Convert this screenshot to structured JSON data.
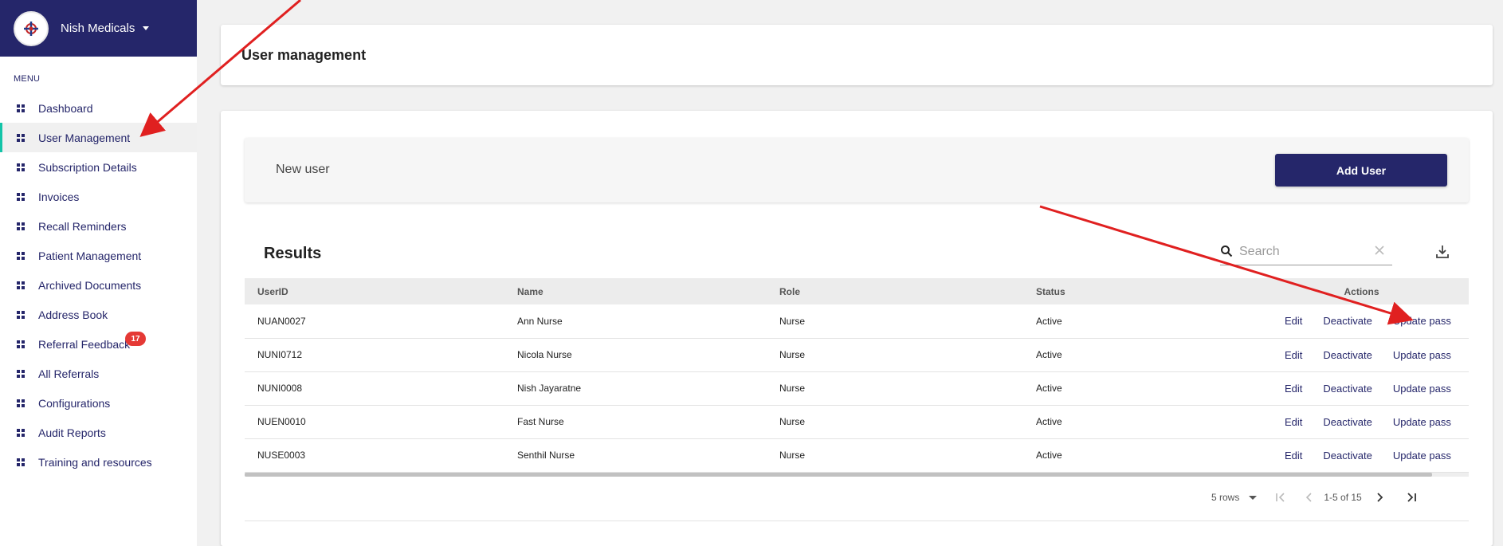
{
  "brand": {
    "name": "Nish Medicals",
    "logo_icon": "nish-medicals-logo-icon"
  },
  "sidebar": {
    "menu_title": "MENU",
    "items": [
      {
        "label": "Dashboard",
        "icon": "dashboard-icon",
        "active": false
      },
      {
        "label": "User Management",
        "icon": "dashboard-icon",
        "active": true
      },
      {
        "label": "Subscription Details",
        "icon": "dashboard-icon",
        "active": false
      },
      {
        "label": "Invoices",
        "icon": "dashboard-icon",
        "active": false
      },
      {
        "label": "Recall Reminders",
        "icon": "dashboard-icon",
        "active": false
      },
      {
        "label": "Patient Management",
        "icon": "dashboard-icon",
        "active": false
      },
      {
        "label": "Archived Documents",
        "icon": "dashboard-icon",
        "active": false
      },
      {
        "label": "Address Book",
        "icon": "dashboard-icon",
        "active": false
      },
      {
        "label": "Referral Feedback",
        "icon": "dashboard-icon",
        "active": false,
        "badge": "17"
      },
      {
        "label": "All Referrals",
        "icon": "dashboard-icon",
        "active": false
      },
      {
        "label": "Configurations",
        "icon": "dashboard-icon",
        "active": false
      },
      {
        "label": "Audit Reports",
        "icon": "dashboard-icon",
        "active": false
      },
      {
        "label": "Training and resources",
        "icon": "dashboard-icon",
        "active": false
      }
    ]
  },
  "header": {
    "title": "User management"
  },
  "new_user": {
    "label": "New user",
    "button_label": "Add User"
  },
  "results": {
    "title": "Results",
    "search_placeholder": "Search",
    "columns": [
      "UserID",
      "Name",
      "Role",
      "Status",
      "Actions"
    ],
    "rows": [
      {
        "userid": "NUAN0027",
        "name": "Ann Nurse",
        "role": "Nurse",
        "status": "Active"
      },
      {
        "userid": "NUNI0712",
        "name": "Nicola Nurse",
        "role": "Nurse",
        "status": "Active"
      },
      {
        "userid": "NUNI0008",
        "name": "Nish Jayaratne",
        "role": "Nurse",
        "status": "Active"
      },
      {
        "userid": "NUEN0010",
        "name": "Fast Nurse",
        "role": "Nurse",
        "status": "Active"
      },
      {
        "userid": "NUSE0003",
        "name": "Senthil Nurse",
        "role": "Nurse",
        "status": "Active"
      }
    ],
    "actions": {
      "edit": "Edit",
      "deactivate": "Deactivate",
      "update": "Update pass"
    }
  },
  "pagination": {
    "rows_per_page": "5 rows",
    "range": "1-5 of 15"
  },
  "colors": {
    "primary": "#25266a",
    "accent": "#13c4a8",
    "badge": "#e53935",
    "arrow": "#e02020"
  }
}
